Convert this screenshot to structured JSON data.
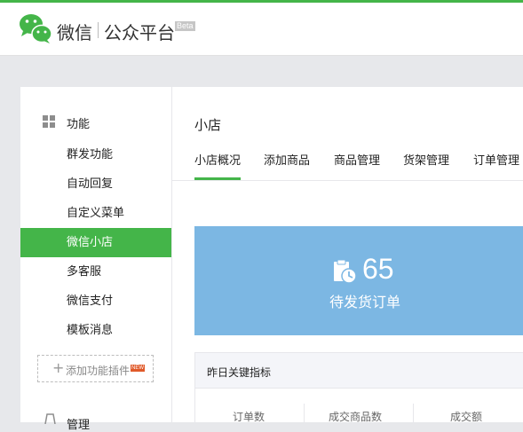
{
  "header": {
    "brand": "微信",
    "platform": "公众平台",
    "badge": "Beta"
  },
  "sidebar": {
    "section_function": "功能",
    "items": [
      {
        "label": "群发功能",
        "active": false
      },
      {
        "label": "自动回复",
        "active": false
      },
      {
        "label": "自定义菜单",
        "active": false
      },
      {
        "label": "微信小店",
        "active": true
      },
      {
        "label": "多客服",
        "active": false
      },
      {
        "label": "微信支付",
        "active": false
      },
      {
        "label": "模板消息",
        "active": false
      }
    ],
    "add_plugin": {
      "label": "添加功能插件",
      "badge": "NEW"
    },
    "section_manage": "管理"
  },
  "main": {
    "title": "小店",
    "tabs": [
      {
        "label": "小店概况",
        "active": true
      },
      {
        "label": "添加商品",
        "active": false
      },
      {
        "label": "商品管理",
        "active": false
      },
      {
        "label": "货架管理",
        "active": false
      },
      {
        "label": "订单管理",
        "active": false
      }
    ],
    "pending_orders": {
      "count": "65",
      "label": "待发货订单"
    },
    "metrics": {
      "title": "昨日关键指标",
      "columns": [
        "订单数",
        "成交商品数",
        "成交额"
      ]
    }
  },
  "colors": {
    "accent": "#44b549",
    "card": "#7cb7e3"
  }
}
